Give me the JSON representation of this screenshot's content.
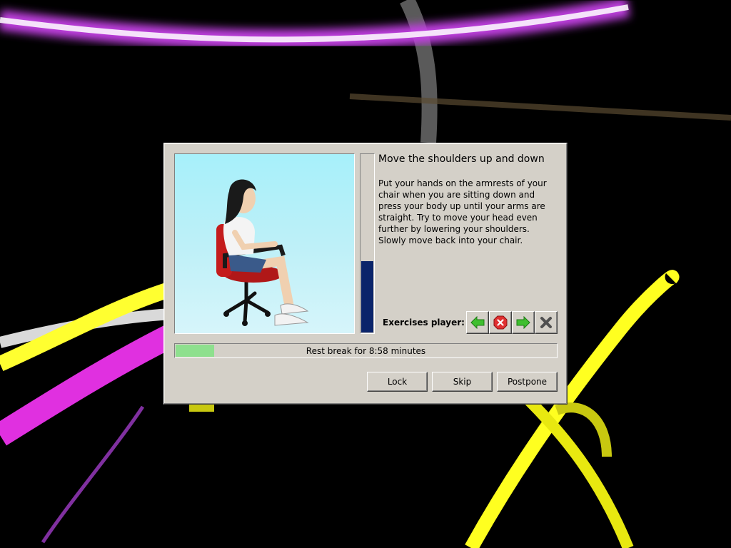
{
  "exercise": {
    "title": "Move the shoulders up and down",
    "description": "Put your hands on the armrests of your chair when you are sitting down and press your body up until your arms are straight. Try to move your head even further by lowering your shoulders. Slowly move back into your chair.",
    "progress": 0.4
  },
  "player": {
    "label": "Exercises player:",
    "buttons": [
      {
        "name": "previous",
        "icon": "arrow-left-icon"
      },
      {
        "name": "stop",
        "icon": "stop-icon"
      },
      {
        "name": "next",
        "icon": "arrow-right-icon"
      },
      {
        "name": "close",
        "icon": "close-icon"
      }
    ]
  },
  "break": {
    "text": "Rest break for 8:58 minutes",
    "progress": 0.1
  },
  "buttons": {
    "lock": "Lock",
    "skip": "Skip",
    "postpone": "Postpone"
  },
  "colors": {
    "dialog_bg": "#d4d0c8",
    "exercise_progress": "#0a246a",
    "break_progress": "#8ee08e",
    "arrow_green": "#3fbf2f",
    "stop_red": "#e03030"
  }
}
